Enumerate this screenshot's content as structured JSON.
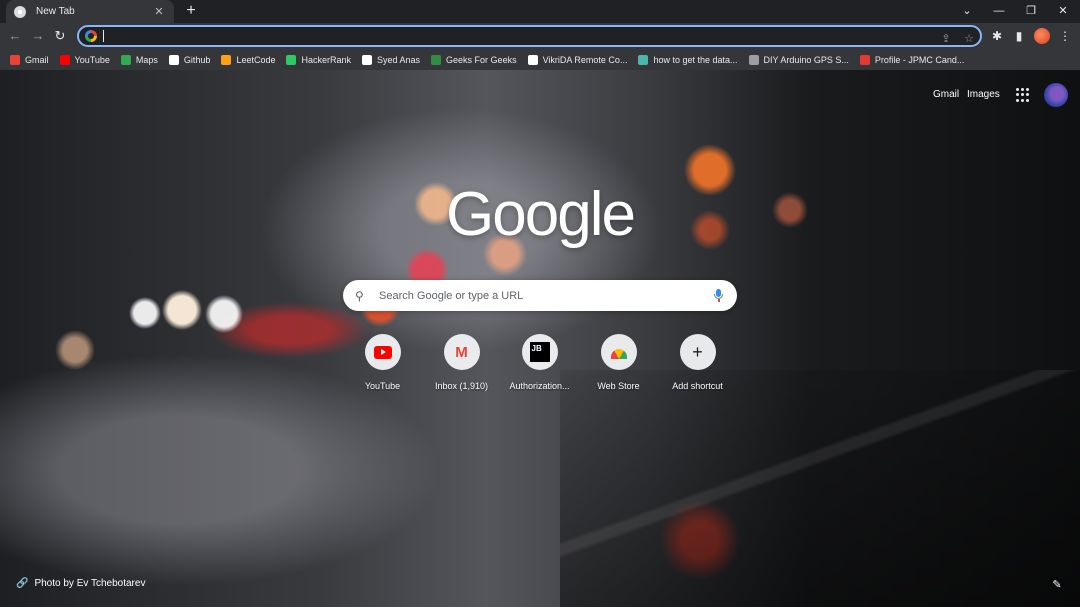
{
  "tab": {
    "title": "New Tab",
    "close_icon": "close-icon",
    "favicon": "chrome-icon"
  },
  "window": {
    "new_tab_icon": "plus-icon",
    "tab_search_icon": "chevron-down-icon",
    "minimize_icon": "minimize-icon",
    "restore_icon": "restore-icon",
    "close_icon": "close-icon"
  },
  "toolbar": {
    "back_icon": "back-arrow-icon",
    "forward_icon": "forward-arrow-icon",
    "reload_icon": "reload-icon",
    "omnibox_value": "",
    "share_icon": "share-icon",
    "bookmark_star_icon": "star-icon",
    "extensions_icon": "puzzle-icon",
    "side_panel_icon": "side-panel-icon",
    "profile_icon": "profile-avatar",
    "menu_icon": "kebab-menu-icon"
  },
  "bookmarks": [
    {
      "label": "Gmail",
      "color": "#ea4335"
    },
    {
      "label": "YouTube",
      "color": "#ff0000"
    },
    {
      "label": "Maps",
      "color": "#34a853"
    },
    {
      "label": "Github",
      "color": "#ffffff"
    },
    {
      "label": "LeetCode",
      "color": "#ffa116"
    },
    {
      "label": "HackerRank",
      "color": "#2ec866"
    },
    {
      "label": "Syed Anas",
      "color": "#ffffff"
    },
    {
      "label": "Geeks For Geeks",
      "color": "#2f8d46"
    },
    {
      "label": "VikriDA Remote Co...",
      "color": "#ffffff"
    },
    {
      "label": "how to get the data...",
      "color": "#4db6ac"
    },
    {
      "label": "DIY Arduino GPS S...",
      "color": "#9e9e9e"
    },
    {
      "label": "Profile - JPMC Cand...",
      "color": "#e53935"
    }
  ],
  "ntp": {
    "top_links": {
      "gmail": "Gmail",
      "images": "Images"
    },
    "apps_icon": "apps-grid-icon",
    "logo": "Google",
    "search": {
      "placeholder": "Search Google or type a URL",
      "search_icon": "search-icon",
      "mic_icon": "mic-icon"
    },
    "shortcuts": [
      {
        "label": "YouTube",
        "icon": "youtube-icon"
      },
      {
        "label": "Inbox (1,910)",
        "icon": "gmail-icon"
      },
      {
        "label": "Authorization...",
        "icon": "jetbrains-icon"
      },
      {
        "label": "Web Store",
        "icon": "web-store-icon"
      },
      {
        "label": "Add shortcut",
        "icon": "plus-icon"
      }
    ],
    "photo_credit": "Photo by Ev Tchebotarev",
    "customize_icon": "pencil-icon"
  }
}
